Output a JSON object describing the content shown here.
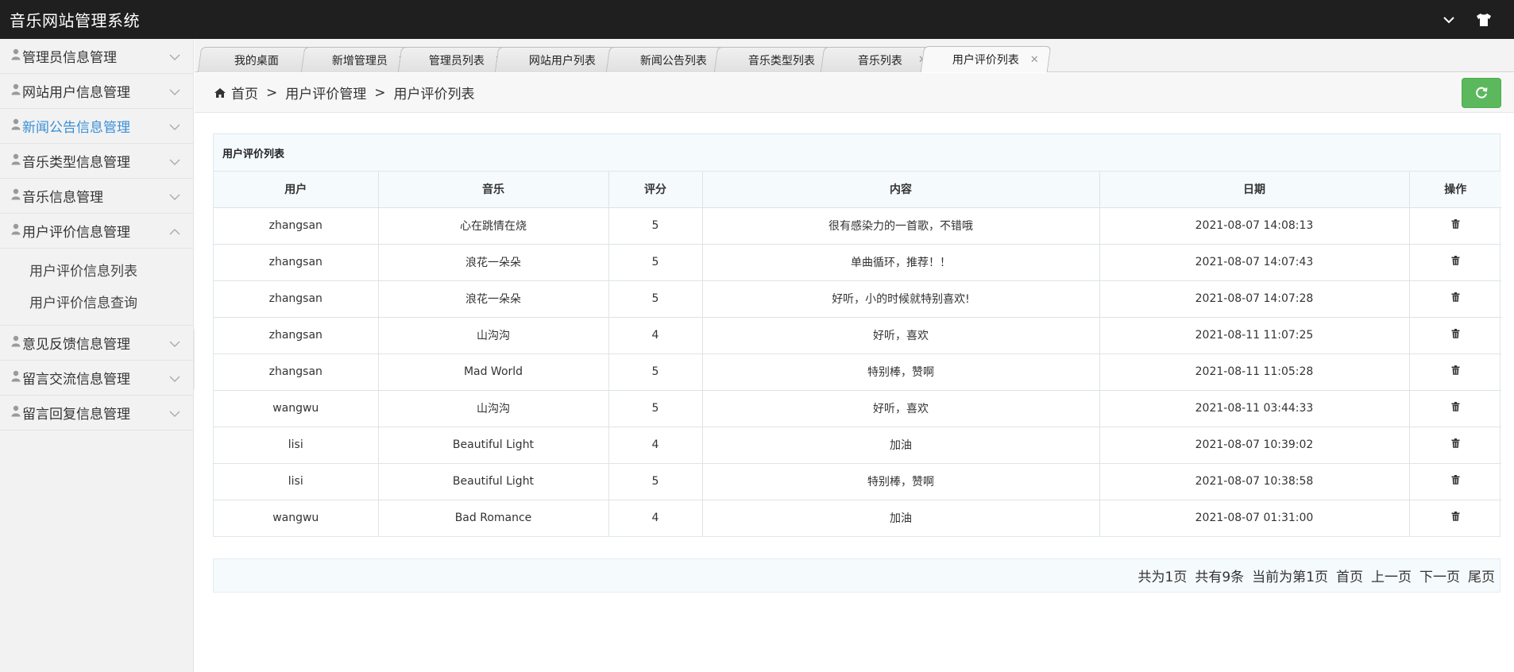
{
  "app": {
    "title": "音乐网站管理系统"
  },
  "topbar": {
    "icons": [
      "chevron-down-icon",
      "shirt-icon"
    ]
  },
  "sidebar": {
    "items": [
      {
        "label": "管理员信息管理",
        "expanded": false,
        "active": false
      },
      {
        "label": "网站用户信息管理",
        "expanded": false,
        "active": false
      },
      {
        "label": "新闻公告信息管理",
        "expanded": false,
        "active": true
      },
      {
        "label": "音乐类型信息管理",
        "expanded": false,
        "active": false
      },
      {
        "label": "音乐信息管理",
        "expanded": false,
        "active": false
      },
      {
        "label": "用户评价信息管理",
        "expanded": true,
        "active": false,
        "children": [
          {
            "label": "用户评价信息列表"
          },
          {
            "label": "用户评价信息查询"
          }
        ]
      },
      {
        "label": "意见反馈信息管理",
        "expanded": false,
        "active": false
      },
      {
        "label": "留言交流信息管理",
        "expanded": false,
        "active": false
      },
      {
        "label": "留言回复信息管理",
        "expanded": false,
        "active": false
      }
    ]
  },
  "tabs": [
    {
      "label": "我的桌面",
      "closable": false,
      "active": false
    },
    {
      "label": "新增管理员",
      "closable": true,
      "active": false
    },
    {
      "label": "管理员列表",
      "closable": true,
      "active": false
    },
    {
      "label": "网站用户列表",
      "closable": true,
      "active": false
    },
    {
      "label": "新闻公告列表",
      "closable": true,
      "active": false
    },
    {
      "label": "音乐类型列表",
      "closable": true,
      "active": false
    },
    {
      "label": "音乐列表",
      "closable": true,
      "active": false
    },
    {
      "label": "用户评价列表",
      "closable": true,
      "active": true
    }
  ],
  "breadcrumb": {
    "home": "首页",
    "sep": ">",
    "level1": "用户评价管理",
    "level2": "用户评价列表"
  },
  "panel": {
    "title": "用户评价列表"
  },
  "table": {
    "columns": [
      "用户",
      "音乐",
      "评分",
      "内容",
      "日期",
      "操作"
    ],
    "rows": [
      [
        "zhangsan",
        "心在跳情在烧",
        "5",
        "很有感染力的一首歌，不错哦",
        "2021-08-07 14:08:13"
      ],
      [
        "zhangsan",
        "浪花一朵朵",
        "5",
        "单曲循环，推荐！！",
        "2021-08-07 14:07:43"
      ],
      [
        "zhangsan",
        "浪花一朵朵",
        "5",
        "好听，小的时候就特别喜欢!",
        "2021-08-07 14:07:28"
      ],
      [
        "zhangsan",
        "山沟沟",
        "4",
        "好听，喜欢",
        "2021-08-11 11:07:25"
      ],
      [
        "zhangsan",
        "Mad World",
        "5",
        "特别棒，赞啊",
        "2021-08-11 11:05:28"
      ],
      [
        "wangwu",
        "山沟沟",
        "5",
        "好听，喜欢",
        "2021-08-11 03:44:33"
      ],
      [
        "lisi",
        "Beautiful Light",
        "4",
        "加油",
        "2021-08-07 10:39:02"
      ],
      [
        "lisi",
        "Beautiful Light",
        "5",
        "特别棒，赞啊",
        "2021-08-07 10:38:58"
      ],
      [
        "wangwu",
        "Bad Romance",
        "4",
        "加油",
        "2021-08-07 01:31:00"
      ]
    ]
  },
  "pager": {
    "total_pages": "共为1页",
    "total_records": "共有9条",
    "current": "当前为第1页",
    "first": "首页",
    "prev": "上一页",
    "next": "下一页",
    "last": "尾页"
  },
  "colors": {
    "topbar": "#1f1f1f",
    "active_menu": "#3a8fd6",
    "refresh_button": "#5cb85c"
  }
}
